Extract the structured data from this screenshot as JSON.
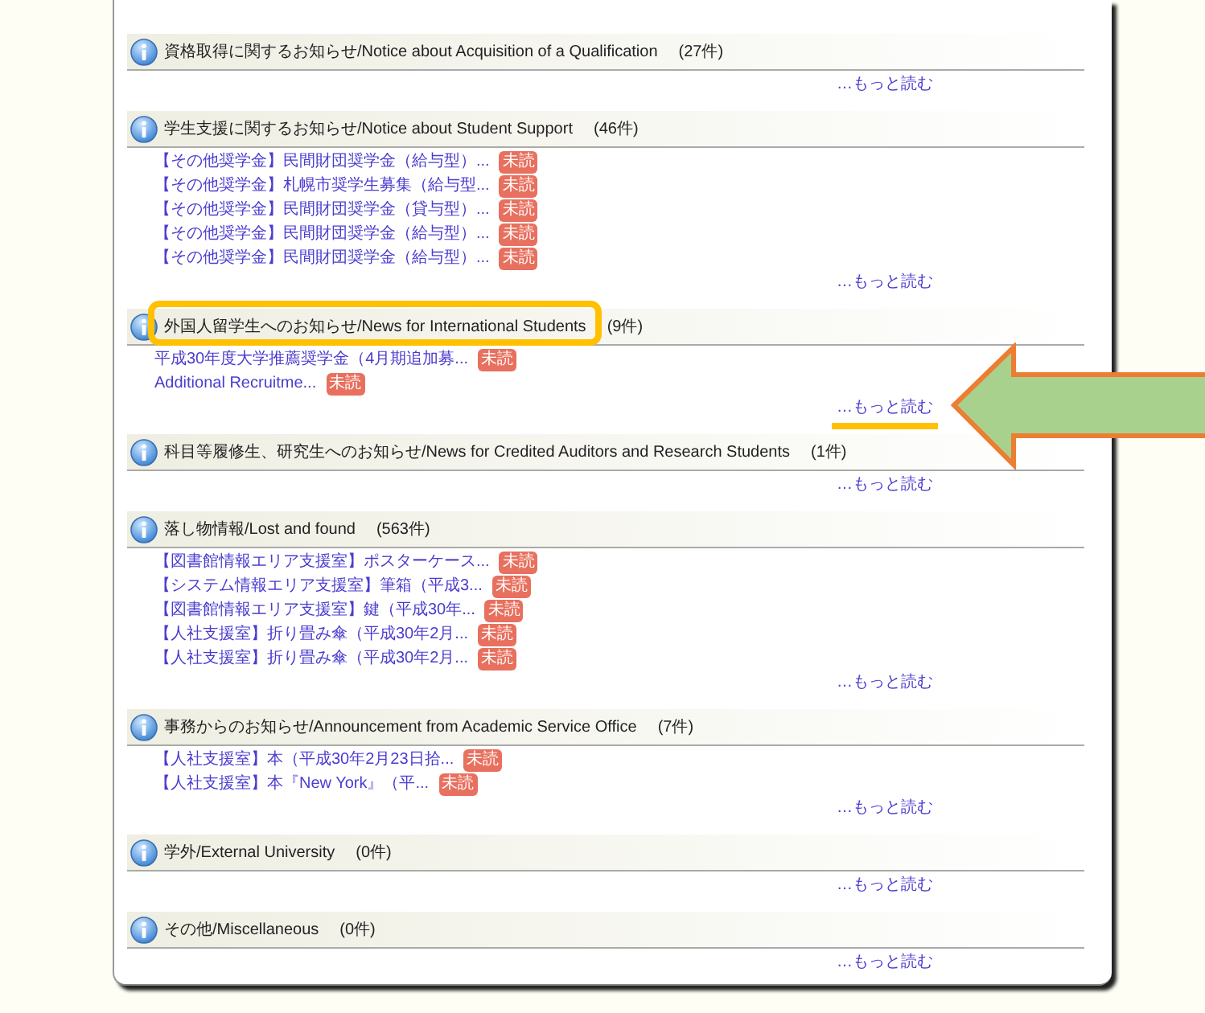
{
  "sections": [
    {
      "title": "資格取得に関するお知らせ/Notice about Acquisition of a Qualification",
      "count": "(27件)",
      "more": "…もっと読む",
      "highlighted": false,
      "more_underlined": false,
      "arrow": false
    },
    {
      "title": "学生支援に関するお知らせ/Notice about Student Support",
      "count": "(46件)",
      "items": [
        {
          "text": "【その他奨学金】民間財団奨学金（給与型）...",
          "badge": "未読"
        },
        {
          "text": "【その他奨学金】札幌市奨学生募集（給与型...",
          "badge": "未読"
        },
        {
          "text": "【その他奨学金】民間財団奨学金（貸与型）...",
          "badge": "未読"
        },
        {
          "text": "【その他奨学金】民間財団奨学金（給与型）...",
          "badge": "未読"
        },
        {
          "text": "【その他奨学金】民間財団奨学金（給与型）...",
          "badge": "未読"
        }
      ],
      "more": "…もっと読む",
      "highlighted": false,
      "more_underlined": false,
      "arrow": false
    },
    {
      "title": "外国人留学生へのお知らせ/News for International Students",
      "count": "(9件)",
      "items": [
        {
          "text": "平成30年度大学推薦奨学金（4月期追加募...",
          "badge": "未読"
        },
        {
          "text": "Additional Recruitme...",
          "badge": "未読"
        }
      ],
      "more": "…もっと読む",
      "highlighted": true,
      "more_underlined": true,
      "arrow": true
    },
    {
      "title": "科目等履修生、研究生へのお知らせ/News for Credited Auditors and Research Students",
      "count": "(1件)",
      "more": "…もっと読む",
      "highlighted": false,
      "more_underlined": false,
      "arrow": false
    },
    {
      "title": "落し物情報/Lost and found",
      "count": "(563件)",
      "items": [
        {
          "text": "【図書館情報エリア支援室】ポスターケース...",
          "badge": "未読"
        },
        {
          "text": "【システム情報エリア支援室】筆箱（平成3...",
          "badge": "未読"
        },
        {
          "text": "【図書館情報エリア支援室】鍵（平成30年...",
          "badge": "未読"
        },
        {
          "text": "【人社支援室】折り畳み傘（平成30年2月...",
          "badge": "未読"
        },
        {
          "text": "【人社支援室】折り畳み傘（平成30年2月...",
          "badge": "未読"
        }
      ],
      "more": "…もっと読む",
      "highlighted": false,
      "more_underlined": false,
      "arrow": false
    },
    {
      "title": "事務からのお知らせ/Announcement from Academic Service Office",
      "count": "(7件)",
      "items": [
        {
          "text": "【人社支援室】本（平成30年2月23日拾...",
          "badge": "未読"
        },
        {
          "text": "【人社支援室】本『New York』（平...",
          "badge": "未読"
        }
      ],
      "more": "…もっと読む",
      "highlighted": false,
      "more_underlined": false,
      "arrow": false
    },
    {
      "title": "学外/External University",
      "count": "(0件)",
      "more": "…もっと読む",
      "highlighted": false,
      "more_underlined": false,
      "arrow": false
    },
    {
      "title": "その他/Miscellaneous",
      "count": "(0件)",
      "more": "…もっと読む",
      "highlighted": false,
      "more_underlined": false,
      "arrow": false
    }
  ]
}
